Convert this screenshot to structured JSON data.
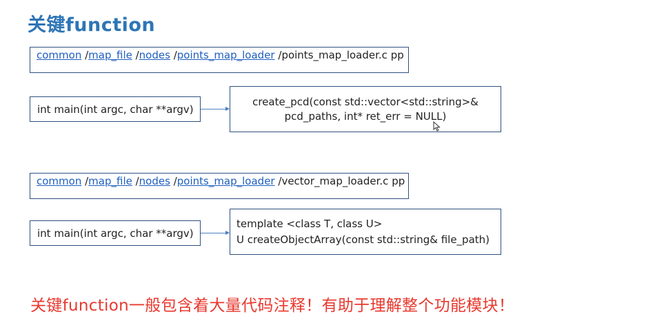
{
  "title": "关键function",
  "section1": {
    "path": {
      "segments": [
        "common",
        "map_file",
        "nodes",
        "points_map_loader"
      ],
      "separator": " /",
      "file": "points_map_loader.c pp"
    },
    "main_signature": "int main(int argc, char **argv)",
    "target_lines": [
      "create_pcd(const std::vector<std::string>&",
      "pcd_paths, int* ret_err = NULL)"
    ]
  },
  "section2": {
    "path": {
      "segments": [
        "common",
        "map_file",
        "nodes",
        "points_map_loader"
      ],
      "separator": " /",
      "file": "vector_map_loader.c pp"
    },
    "main_signature": "int main(int argc, char **argv)",
    "target_lines": [
      "template <class T, class U>",
      "U createObjectArray(const std::string& file_path)"
    ]
  },
  "note": "关键function一般包含着大量代码注释！有助于理解整个功能模块！",
  "colors": {
    "title": "#2e75b6",
    "link": "#1f5fbf",
    "note": "#e8392f",
    "border": "#2f4f7f",
    "arrow": "#4f81bd"
  }
}
